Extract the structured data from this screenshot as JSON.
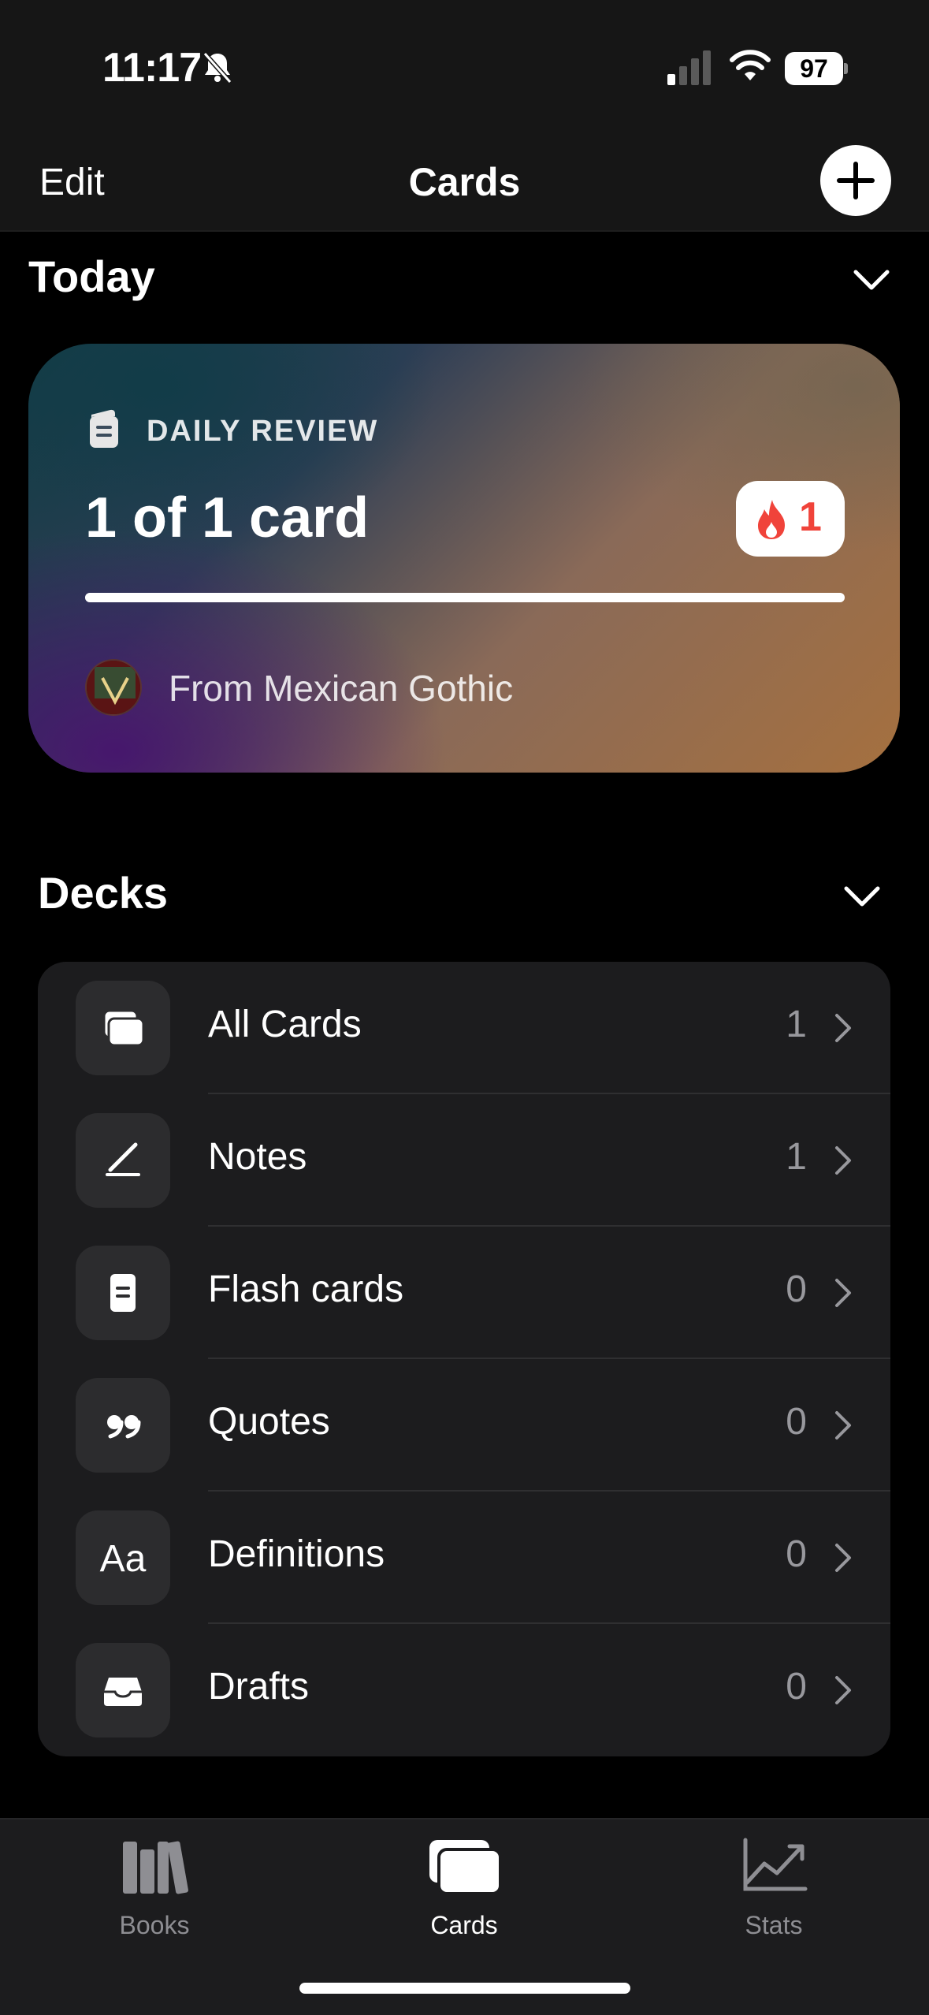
{
  "status_bar": {
    "time": "11:17",
    "battery": "97"
  },
  "nav": {
    "edit_label": "Edit",
    "title": "Cards",
    "add_icon": "plus-icon"
  },
  "today": {
    "title": "Today",
    "review": {
      "label": "DAILY REVIEW",
      "count": "1 of 1 card",
      "streak": "1",
      "progress": 1.0,
      "from": "From Mexican Gothic"
    }
  },
  "decks": {
    "title": "Decks",
    "items": [
      {
        "label": "All Cards",
        "count": "1",
        "icon": "cards-stack-icon"
      },
      {
        "label": "Notes",
        "count": "1",
        "icon": "pencil-icon"
      },
      {
        "label": "Flash cards",
        "count": "0",
        "icon": "flashcard-icon"
      },
      {
        "label": "Quotes",
        "count": "0",
        "icon": "quote-icon"
      },
      {
        "label": "Definitions",
        "count": "0",
        "icon": "aa-icon",
        "icon_text": "Aa"
      },
      {
        "label": "Drafts",
        "count": "0",
        "icon": "tray-icon"
      }
    ]
  },
  "tabs": [
    {
      "label": "Books",
      "icon": "books-icon",
      "active": false
    },
    {
      "label": "Cards",
      "icon": "cards-icon",
      "active": true
    },
    {
      "label": "Stats",
      "icon": "chart-icon",
      "active": false
    }
  ],
  "colors": {
    "accent_streak": "#f0433a",
    "tab_inactive": "#8e8e93",
    "tab_active": "#ffffff"
  }
}
